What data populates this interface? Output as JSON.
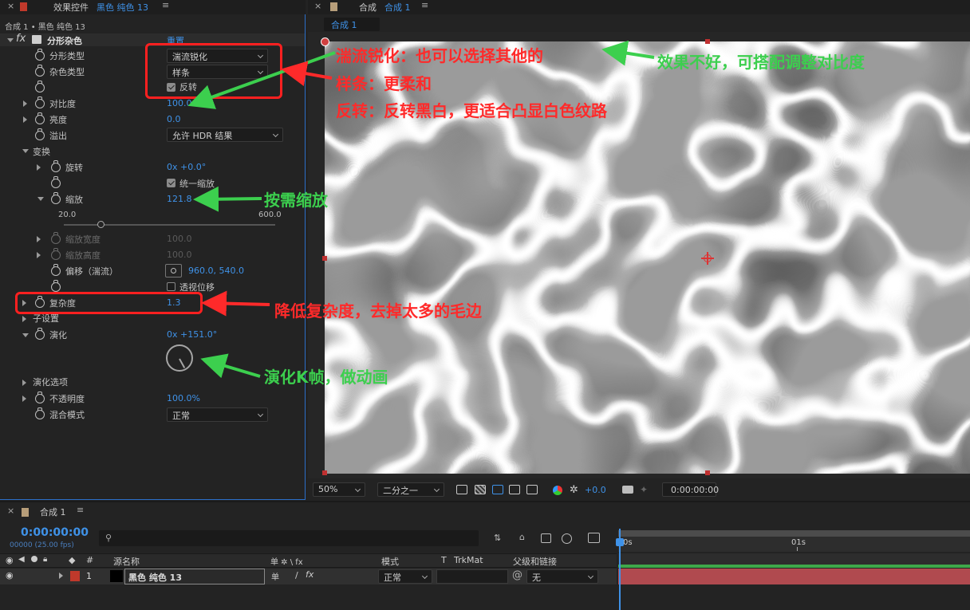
{
  "effects_panel": {
    "tab_label": "效果控件",
    "layer_name": "黑色 纯色 13",
    "breadcrumb": "合成 1 • 黑色 纯色 13",
    "effect_name": "分形杂色",
    "reset_label": "重置",
    "fractal_type_label": "分形类型",
    "fractal_type_value": "湍流锐化",
    "noise_type_label": "杂色类型",
    "noise_type_value": "样条",
    "invert_label": "反转",
    "contrast_label": "对比度",
    "contrast_value": "100.0",
    "brightness_label": "亮度",
    "brightness_value": "0.0",
    "overflow_label": "溢出",
    "overflow_value": "允许 HDR 结果",
    "transform_label": "变换",
    "rotation_label": "旋转",
    "rotation_value": "0x +0.0°",
    "uniform_scale_label": "统一缩放",
    "scale_label": "缩放",
    "scale_value": "121.8",
    "slider_min": "20.0",
    "slider_max": "600.0",
    "scale_slider_fraction": 0.175,
    "scale_width_label": "缩放宽度",
    "scale_width_value": "100.0",
    "scale_height_label": "缩放高度",
    "scale_height_value": "100.0",
    "offset_label": "偏移（湍流）",
    "offset_value": "960.0, 540.0",
    "perspective_label": "透视位移",
    "complexity_label": "复杂度",
    "complexity_value": "1.3",
    "sub_settings_label": "子设置",
    "evolution_label": "演化",
    "evolution_value": "0x +151.0°",
    "evolution_options_label": "演化选项",
    "opacity_label": "不透明度",
    "opacity_value": "100.0%",
    "blend_label": "混合模式",
    "blend_value": "正常"
  },
  "comp_panel": {
    "tab_title": "合成",
    "comp_name": "合成 1",
    "tab_pill": "合成 1",
    "zoom": "50%",
    "resolution": "二分之一",
    "exposure": "+0.0",
    "timecode": "0:00:00:00"
  },
  "timeline": {
    "tab_name": "合成 1",
    "timecode": "0:00:00:00",
    "frame_info": "00000 (25.00 fps)",
    "search_placeholder": "",
    "col_number": "#",
    "col_source": "源名称",
    "col_switches": "单 ✲ \\ fx",
    "col_mode": "模式",
    "col_t": "T",
    "col_trkmat": "TrkMat",
    "col_parent": "父级和链接",
    "ruler_0": "0s",
    "ruler_1": "01s",
    "layer_index": "1",
    "layer_name": "黑色 纯色 13",
    "layer_mode": "正常",
    "layer_parent": "无",
    "layer_color": "#c0392b",
    "bar_color": "#b04a4f"
  },
  "annotations": {
    "a1": "湍流锐化：也可以选择其他的",
    "a2": "效果不好，可搭配调整对比度",
    "a3": "样条：更柔和",
    "a4": "反转：反转黑白，更适合凸显白色纹路",
    "a5": "按需缩放",
    "a6": "降低复杂度，去掉太多的毛边",
    "a7": "演化K帧，做动画"
  }
}
